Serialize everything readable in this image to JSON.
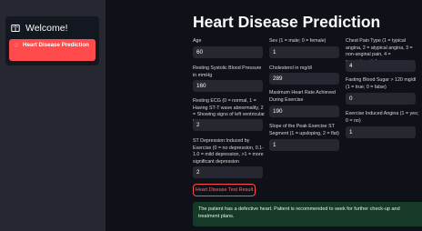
{
  "sidebar": {
    "menu_title": "Welcome!",
    "menu_items": [
      {
        "label": "Heart Disease Prediction",
        "icon": "heart-icon",
        "active": true
      }
    ],
    "accent_color": "#ff4b4b"
  },
  "main": {
    "title": "Heart Disease Prediction",
    "fields": {
      "age": {
        "label": "Age",
        "value": "60"
      },
      "sex": {
        "label": "Sex (1 = male; 0 = female)",
        "value": "1"
      },
      "cp": {
        "label": "Chest Pain Type (1 = typical angina, 2 = atypical angina, 3 = non-anginal pain, 4 = asymptomatic)",
        "value": "4"
      },
      "trestbps": {
        "label": "Resting Systolic Blood Pressure in mmHg",
        "value": "160"
      },
      "chol": {
        "label": "Cholesterol in mg/dl",
        "value": "289"
      },
      "fbs": {
        "label": "Fasting Blood Sugar > 120 mg/dl (1 = true; 0 = false)",
        "value": "0"
      },
      "restecg": {
        "label": "Resting ECG (0 = normal, 1 = Having ST-T wave abnormality, 2 = Showing signs of left ventricular hypertrophy)",
        "value": "2"
      },
      "thalach": {
        "label": "Maximum Heart Rate Achieved During Exercise",
        "value": "190"
      },
      "exang": {
        "label": "Exercise Induced Angina (1 = yes; 0 = no)",
        "value": "1"
      },
      "slope": {
        "label": "Slope of the Peak Exercise ST Segment (1 = upsloping, 2 = flat)",
        "value": "1"
      },
      "oldpeak": {
        "label": "ST Depression Induced by Exercise (0 = no depression, 0.1-1.0 = mild depression, >1 = more significant depression",
        "value": "2"
      }
    },
    "button_label": "Heart Disease Test Result",
    "result_message": "The patient has a defective heart. Patient is recommended to seek for further check-up and treatment plans."
  }
}
